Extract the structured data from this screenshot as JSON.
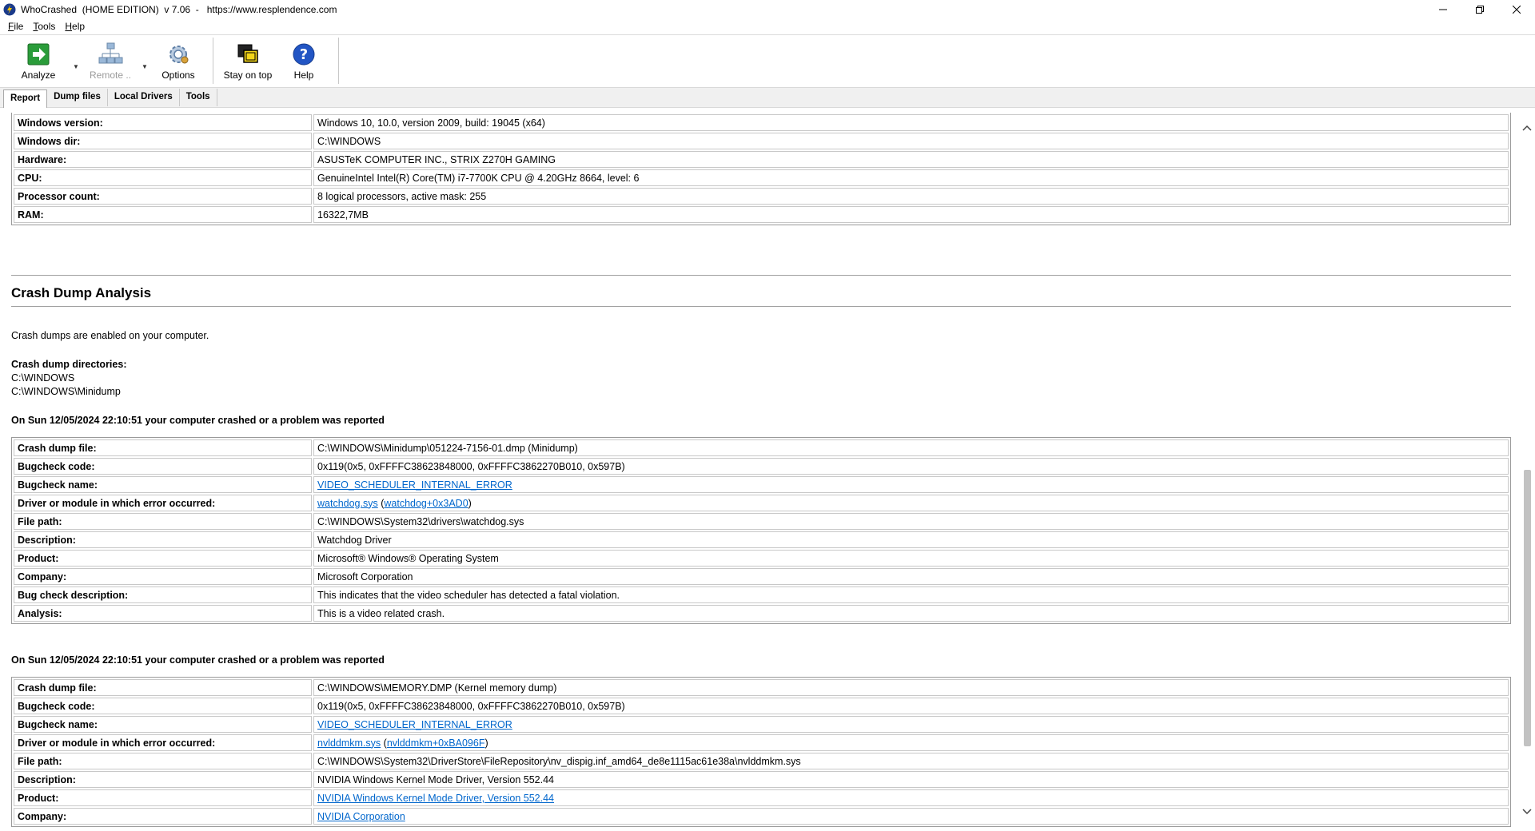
{
  "window": {
    "title": "WhoCrashed  (HOME EDITION)  v 7.06  -   https://www.resplendence.com",
    "minimize": "—",
    "maximize": "❐",
    "close": "✕",
    "icon": "whocrashed-app-icon"
  },
  "menu": [
    {
      "label": "File",
      "accel": "F",
      "rest": "ile"
    },
    {
      "label": "Tools",
      "accel": "T",
      "rest": "ools"
    },
    {
      "label": "Help",
      "accel": "H",
      "rest": "elp"
    }
  ],
  "toolbar": {
    "analyze": {
      "label": "Analyze",
      "icon": "analyze-arrow-icon"
    },
    "remote": {
      "label": "Remote ..",
      "icon": "network-icon",
      "disabled": true
    },
    "options": {
      "label": "Options",
      "icon": "gear-icon"
    },
    "stay_on_top": {
      "label": "Stay on top",
      "icon": "stay-on-top-icon"
    },
    "help": {
      "label": "Help",
      "icon": "help-icon"
    }
  },
  "tabs": [
    {
      "label": "Report",
      "active": true
    },
    {
      "label": "Dump files",
      "active": false
    },
    {
      "label": "Local Drivers",
      "active": false
    },
    {
      "label": "Tools",
      "active": false
    }
  ],
  "system_info": [
    {
      "key": "Windows version:",
      "value": "Windows 10, 10.0, version 2009, build: 19045 (x64)"
    },
    {
      "key": "Windows dir:",
      "value": "C:\\WINDOWS"
    },
    {
      "key": "Hardware:",
      "value": "ASUSTeK COMPUTER INC., STRIX Z270H GAMING"
    },
    {
      "key": "CPU:",
      "value": "GenuineIntel Intel(R) Core(TM) i7-7700K CPU @ 4.20GHz 8664, level: 6"
    },
    {
      "key": "Processor count:",
      "value": "8 logical processors, active mask: 255"
    },
    {
      "key": "RAM:",
      "value": "16322,7MB"
    }
  ],
  "crash_analysis": {
    "heading": "Crash Dump Analysis",
    "enabled_text": "Crash dumps are enabled on your computer.",
    "dirs_label": "Crash dump directories:",
    "dirs": [
      "C:\\WINDOWS",
      "C:\\WINDOWS\\Minidump"
    ]
  },
  "crash1": {
    "heading": "On Sun 12/05/2024 22:10:51 your computer crashed or a problem was reported",
    "dump_file_k": "Crash dump file:",
    "dump_file_v": "C:\\WINDOWS\\Minidump\\051224-7156-01.dmp (Minidump)",
    "bugcheck_code_k": "Bugcheck code:",
    "bugcheck_code_v": "0x119(0x5, 0xFFFFC38623848000, 0xFFFFC3862270B010, 0x597B)",
    "bugcheck_name_k": "Bugcheck name:",
    "bugcheck_name_v": "VIDEO_SCHEDULER_INTERNAL_ERROR",
    "driver_k": "Driver or module in which error occurred:",
    "driver_link1": "watchdog.sys",
    "driver_open": " (",
    "driver_link2": "watchdog+0x3AD0",
    "driver_close": ")",
    "file_path_k": "File path:",
    "file_path_v": "C:\\WINDOWS\\System32\\drivers\\watchdog.sys",
    "description_k": "Description:",
    "description_v": "Watchdog Driver",
    "product_k": "Product:",
    "product_v": "Microsoft® Windows® Operating System",
    "company_k": "Company:",
    "company_v": "Microsoft Corporation",
    "bug_desc_k": "Bug check description:",
    "bug_desc_v": "This indicates that the video scheduler has detected a fatal violation.",
    "analysis_k": "Analysis:",
    "analysis_v": "This is a video related crash."
  },
  "crash2": {
    "heading": "On Sun 12/05/2024 22:10:51 your computer crashed or a problem was reported",
    "dump_file_k": "Crash dump file:",
    "dump_file_v": "C:\\WINDOWS\\MEMORY.DMP (Kernel memory dump)",
    "bugcheck_code_k": "Bugcheck code:",
    "bugcheck_code_v": "0x119(0x5, 0xFFFFC38623848000, 0xFFFFC3862270B010, 0x597B)",
    "bugcheck_name_k": "Bugcheck name:",
    "bugcheck_name_v": "VIDEO_SCHEDULER_INTERNAL_ERROR",
    "driver_k": "Driver or module in which error occurred:",
    "driver_link1": "nvlddmkm.sys",
    "driver_open": " (",
    "driver_link2": "nvlddmkm+0xBA096F",
    "driver_close": ")",
    "file_path_k": "File path:",
    "file_path_v": "C:\\WINDOWS\\System32\\DriverStore\\FileRepository\\nv_dispig.inf_amd64_de8e1115ac61e38a\\nvlddmkm.sys",
    "description_k": "Description:",
    "description_v": "NVIDIA Windows Kernel Mode Driver, Version 552.44",
    "product_k": "Product:",
    "product_v": "NVIDIA Windows Kernel Mode Driver, Version 552.44",
    "company_k": "Company:",
    "company_v": "NVIDIA Corporation"
  },
  "scrollbar": {
    "up": "^",
    "down": "v"
  }
}
